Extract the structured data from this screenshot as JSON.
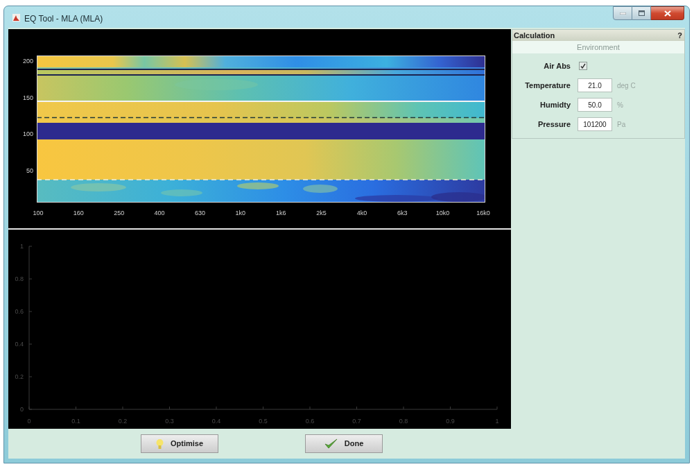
{
  "window": {
    "title": "EQ Tool - MLA (MLA)"
  },
  "spectrogram": {
    "y_tick_labels": [
      "200",
      "150",
      "100",
      "50"
    ],
    "x_tick_labels": [
      "100",
      "160",
      "250",
      "400",
      "630",
      "1k0",
      "1k6",
      "2k5",
      "4k0",
      "6k3",
      "10k0",
      "16k0"
    ]
  },
  "lower_axes": {
    "chart_data": [
      {
        "type": "line",
        "xlim": [
          0,
          1
        ],
        "ylim": [
          0,
          1
        ],
        "xticks": [
          0,
          0.1,
          0.2,
          0.3,
          0.4,
          0.5,
          0.6,
          0.7,
          0.8,
          0.9,
          1
        ],
        "yticks": [
          0,
          0.2,
          0.4,
          0.6,
          0.8,
          1
        ]
      }
    ]
  },
  "calculation_panel": {
    "title": "Calculation",
    "help": "?",
    "section": "Environment",
    "fields": [
      {
        "kind": "checkbox",
        "label": "Air Abs",
        "checked": true
      },
      {
        "kind": "number",
        "label": "Temperature",
        "value": "21.0",
        "unit": "deg C"
      },
      {
        "kind": "number",
        "label": "Humidty",
        "value": "50.0",
        "unit": "%"
      },
      {
        "kind": "number",
        "label": "Pressure",
        "value": "101200",
        "unit": "Pa"
      }
    ]
  },
  "buttons": [
    {
      "label": "Optimise"
    },
    {
      "label": "Done"
    }
  ]
}
